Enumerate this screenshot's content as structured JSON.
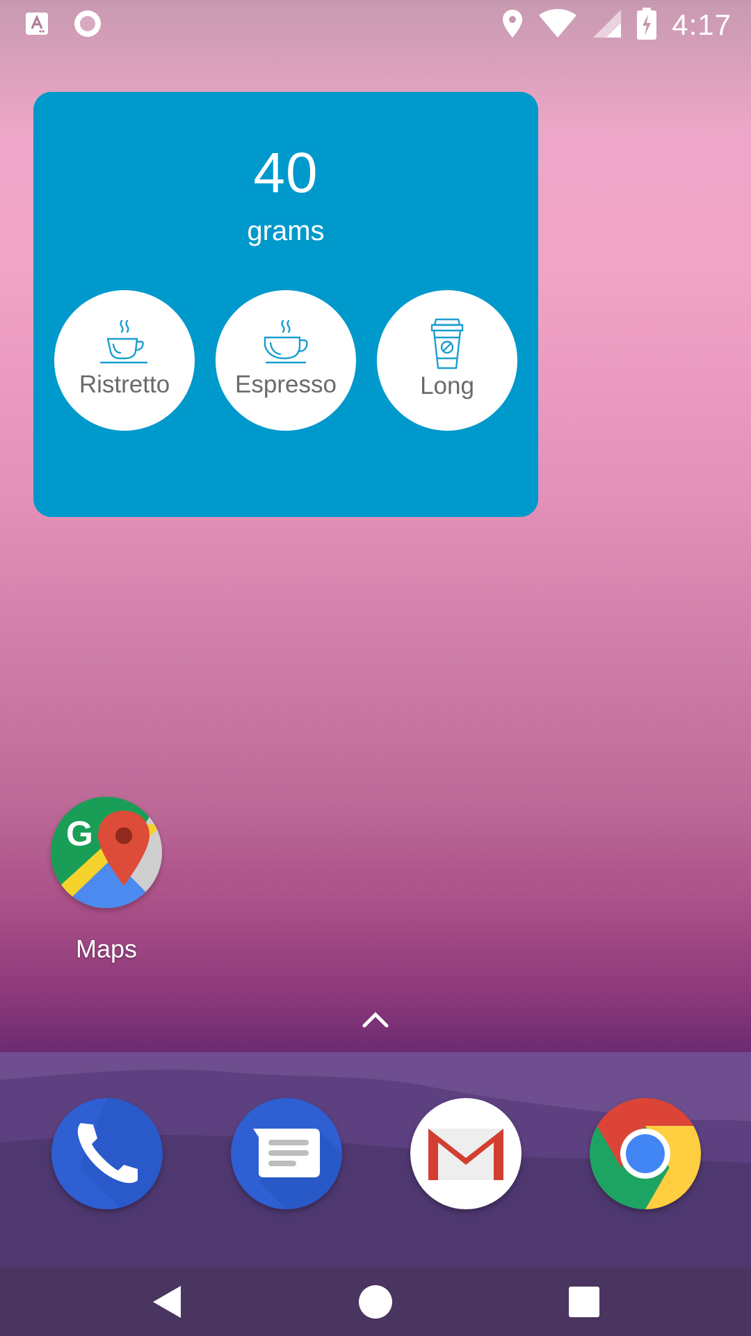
{
  "status_bar": {
    "time": "4:17",
    "icons": [
      "text-assist-icon",
      "record-icon",
      "location-icon",
      "wifi-icon",
      "cell-signal-icon",
      "battery-charging-icon"
    ]
  },
  "widget": {
    "amount_value": "40",
    "amount_unit": "grams",
    "background": "#0099cc",
    "buttons": [
      {
        "label": "Ristretto",
        "icon": "ristretto-cup-icon"
      },
      {
        "label": "Espresso",
        "icon": "espresso-cup-icon"
      },
      {
        "label": "Long",
        "icon": "takeaway-cup-icon"
      }
    ]
  },
  "home_apps": [
    {
      "label": "Maps",
      "icon": "google-maps-icon"
    }
  ],
  "dock": [
    {
      "icon": "phone-icon"
    },
    {
      "icon": "messages-icon"
    },
    {
      "icon": "gmail-icon"
    },
    {
      "icon": "chrome-icon"
    }
  ],
  "nav_bar": {
    "icons": [
      "back-icon",
      "home-icon",
      "recents-icon"
    ]
  }
}
